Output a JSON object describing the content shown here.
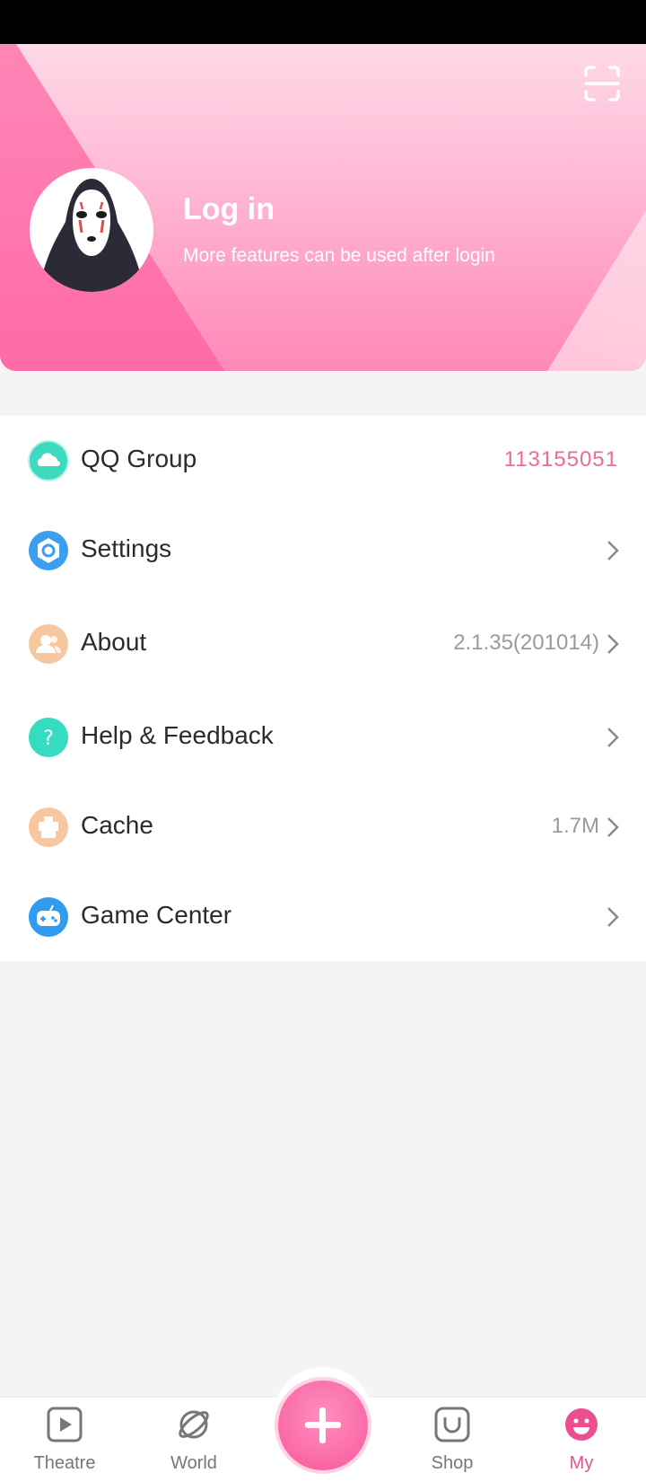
{
  "header": {
    "title": "Log in",
    "subtitle": "More features can be used after login",
    "scan_icon": "scan-icon",
    "avatar_icon": "no-face-mask-avatar"
  },
  "menu": {
    "items": [
      {
        "label": "QQ Group",
        "value": "113155051",
        "icon": "qq-cloud-icon",
        "icon_color": "#3ddac0"
      },
      {
        "label": "Settings",
        "value": "",
        "icon": "settings-ring-icon",
        "icon_color": "#3a9ff0"
      },
      {
        "label": "About",
        "value": "2.1.35(201014)",
        "icon": "people-icon",
        "icon_color": "#f7c8a0"
      },
      {
        "label": "Help & Feedback",
        "value": "",
        "icon": "question-icon",
        "icon_color": "#36dcc1"
      },
      {
        "label": "Cache",
        "value": "1.7M",
        "icon": "cache-icon",
        "icon_color": "#f7c8a0"
      },
      {
        "label": "Game Center",
        "value": "",
        "icon": "gamepad-icon",
        "icon_color": "#2f9cf0"
      }
    ]
  },
  "tabbar": {
    "tabs": [
      {
        "label": "Theatre",
        "icon": "play-icon"
      },
      {
        "label": "World",
        "icon": "planet-icon"
      },
      {
        "label": "Shop",
        "icon": "bag-icon"
      },
      {
        "label": "My",
        "icon": "smiley-icon",
        "active": true
      }
    ],
    "center_icon": "plus-icon"
  },
  "colors": {
    "accent": "#ec4f8f",
    "qq_value": "#ec6a9c",
    "header_pink": "#ff88b8"
  }
}
